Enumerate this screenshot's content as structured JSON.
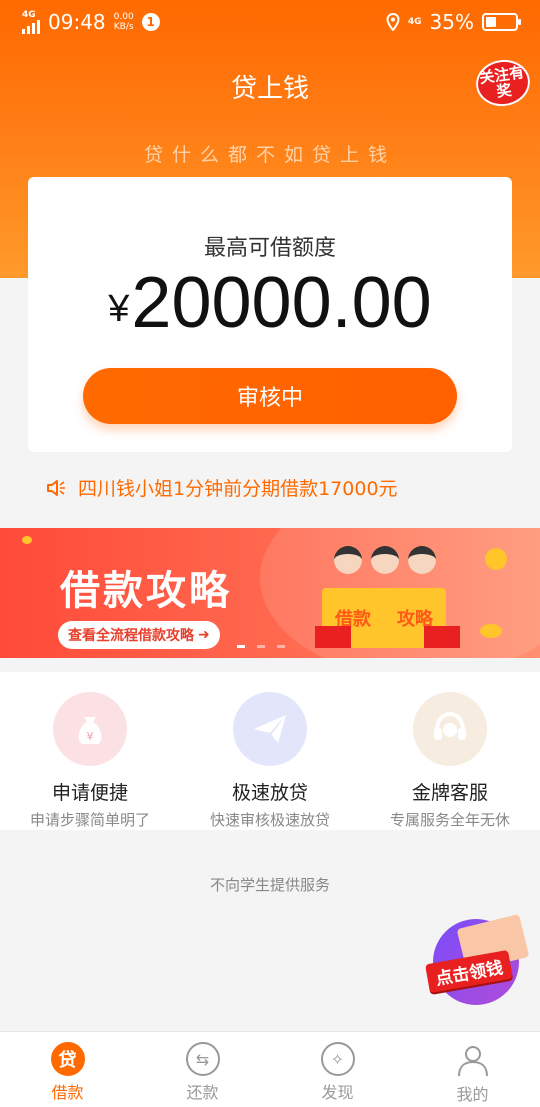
{
  "status_bar": {
    "network": "4G",
    "time": "09:48",
    "speed_value": "0.00",
    "speed_unit": "KB/s",
    "notification_count": "1",
    "network_right": "4G",
    "battery": "35%",
    "battery_level": 0.35
  },
  "header": {
    "title": "贷上钱",
    "follow_badge": "关注有奖",
    "slogan": "贷什么都不如贷上钱"
  },
  "card": {
    "label": "最高可借额度",
    "currency": "¥",
    "amount": "20000.00",
    "button": "审核中"
  },
  "notice": {
    "text": "四川钱小姐1分钟前分期借款17000元",
    "icon": "speaker-icon"
  },
  "banner": {
    "title": "借款攻略",
    "cta": "查看全流程借款攻略",
    "book_left": "借款",
    "book_right": "攻略",
    "slide_count": 3,
    "active_slide": 1
  },
  "features": [
    {
      "icon": "money-bag-icon",
      "title": "申请便捷",
      "subtitle": "申请步骤简单明了",
      "color": "#fbe1e3",
      "fg": "#f0a0a6"
    },
    {
      "icon": "paper-plane-icon",
      "title": "极速放贷",
      "subtitle": "快速审核极速放贷",
      "color": "#e3e6fb",
      "fg": "#a9b0f0"
    },
    {
      "icon": "headset-icon",
      "title": "金牌客服",
      "subtitle": "专属服务全年无休",
      "color": "#f6ece0",
      "fg": "#e3c6a4"
    }
  ],
  "disclaimer": "不向学生提供服务",
  "promo": {
    "label": "点击领钱"
  },
  "tabs": [
    {
      "label": "借款",
      "icon": "loan-icon",
      "glyph": "贷",
      "active": true
    },
    {
      "label": "还款",
      "icon": "repay-icon",
      "glyph": "⇆",
      "active": false
    },
    {
      "label": "发现",
      "icon": "compass-icon",
      "glyph": "✧",
      "active": false
    },
    {
      "label": "我的",
      "icon": "user-icon",
      "glyph": "",
      "active": false
    }
  ],
  "colors": {
    "brand": "#ff6a00",
    "accent_red": "#e8201f"
  }
}
